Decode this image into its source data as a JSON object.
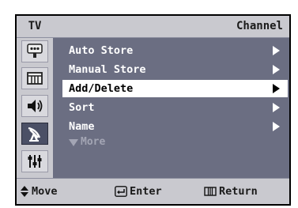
{
  "header": {
    "source_label": "TV",
    "title": "Channel"
  },
  "sidebar": {
    "items": [
      {
        "icon": "input-icon",
        "active": false
      },
      {
        "icon": "picture-icon",
        "active": false
      },
      {
        "icon": "sound-icon",
        "active": false
      },
      {
        "icon": "channel-antenna-icon",
        "active": true
      },
      {
        "icon": "setup-icon",
        "active": false
      }
    ]
  },
  "menu": {
    "items": [
      {
        "label": "Auto Store",
        "selected": false
      },
      {
        "label": "Manual Store",
        "selected": false
      },
      {
        "label": "Add/Delete",
        "selected": true
      },
      {
        "label": "Sort",
        "selected": false
      },
      {
        "label": "Name",
        "selected": false
      }
    ],
    "more_label": "More"
  },
  "footer": {
    "move_label": "Move",
    "enter_label": "Enter",
    "return_label": "Return"
  },
  "colors": {
    "panel": "#6b6e82",
    "bar": "#c9c9cf",
    "selected_row": "#ffffff",
    "text": "#ffffff",
    "dim_text": "#a3a5b4"
  }
}
